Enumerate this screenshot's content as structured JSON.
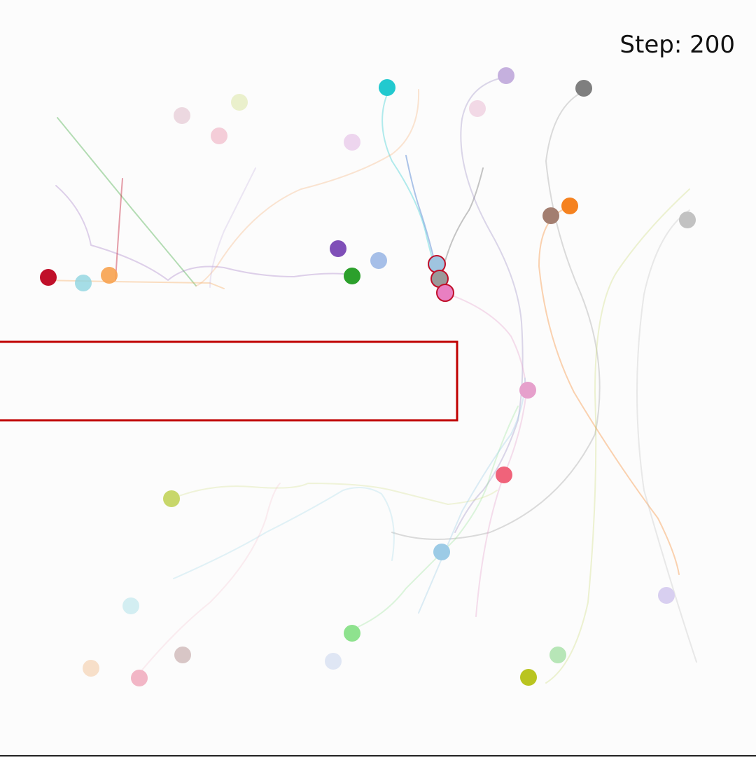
{
  "step_text": "Step: 200",
  "obstacle": {
    "stroke": "#c00000",
    "fill": "none"
  },
  "agents": [
    {
      "id": "red",
      "color": "#c0102a"
    },
    {
      "id": "orange-light",
      "color": "#f7a24f"
    },
    {
      "id": "cyan-light",
      "color": "#8fd5e0"
    },
    {
      "id": "purple",
      "color": "#7f4fb8"
    },
    {
      "id": "blue-light",
      "color": "#9cb8e6"
    },
    {
      "id": "green",
      "color": "#2ca02c"
    },
    {
      "id": "cyan",
      "color": "#22c9cf"
    },
    {
      "id": "lavender",
      "color": "#c5b0de"
    },
    {
      "id": "gray-dark",
      "color": "#7f7f7f"
    },
    {
      "id": "orange",
      "color": "#f58220"
    },
    {
      "id": "brown",
      "color": "#a37e70"
    },
    {
      "id": "gray-light",
      "color": "#c2c2c2"
    },
    {
      "id": "steel",
      "color": "#9fc4e0"
    },
    {
      "id": "gray-mid",
      "color": "#9a9a9a"
    },
    {
      "id": "pink",
      "color": "#e97fc1"
    },
    {
      "id": "pink-mid",
      "color": "#e6a0cc"
    },
    {
      "id": "red-mid",
      "color": "#f0637a"
    },
    {
      "id": "yellowgreen",
      "color": "#c8d76a"
    },
    {
      "id": "skyblue",
      "color": "#9ccbe6"
    },
    {
      "id": "lime",
      "color": "#8ee28e"
    },
    {
      "id": "olive",
      "color": "#b9c420"
    },
    {
      "id": "mint",
      "color": "#b7e6b7"
    },
    {
      "id": "lilac",
      "color": "#d8cff0"
    },
    {
      "id": "rose",
      "color": "#f2b6c6"
    },
    {
      "id": "taupe",
      "color": "#d8c6c6"
    },
    {
      "id": "peach",
      "color": "#f7dfc9"
    },
    {
      "id": "icecyan",
      "color": "#d3eef2"
    },
    {
      "id": "paleblue",
      "color": "#dfe6f4"
    },
    {
      "id": "palepink",
      "color": "#ecd8e0"
    },
    {
      "id": "palerose",
      "color": "#f4cdd8"
    },
    {
      "id": "palecream",
      "color": "#eaf0cc"
    },
    {
      "id": "paleviolet",
      "color": "#edd5ee"
    },
    {
      "id": "palepink2",
      "color": "#f2d9e6"
    }
  ],
  "trails": [
    {
      "id": "t1",
      "color": "#2ca02c"
    },
    {
      "id": "t2",
      "color": "#9467bd"
    },
    {
      "id": "t3",
      "color": "#f7a24f"
    },
    {
      "id": "t4",
      "color": "#c0102a"
    },
    {
      "id": "t5",
      "color": "#22c9cf"
    },
    {
      "id": "t6",
      "color": "#f5a86a"
    },
    {
      "id": "t7",
      "color": "#4a7fd0"
    },
    {
      "id": "t8",
      "color": "#7f7f7f"
    },
    {
      "id": "t9",
      "color": "#8b7ab8"
    },
    {
      "id": "t10",
      "color": "#9a9a9a"
    },
    {
      "id": "t11",
      "color": "#f58220"
    },
    {
      "id": "t12",
      "color": "#c8d76a"
    },
    {
      "id": "t13",
      "color": "#e6a0cc"
    },
    {
      "id": "t14",
      "color": "#bbbbbb"
    },
    {
      "id": "t15",
      "color": "#8ee28e"
    },
    {
      "id": "t16",
      "color": "#c8d76a"
    },
    {
      "id": "t17",
      "color": "#9ccbe6"
    },
    {
      "id": "t18",
      "color": "#c5b0de"
    },
    {
      "id": "t19",
      "color": "#a0d8e8"
    },
    {
      "id": "t20",
      "color": "#f2b6c6"
    }
  ]
}
